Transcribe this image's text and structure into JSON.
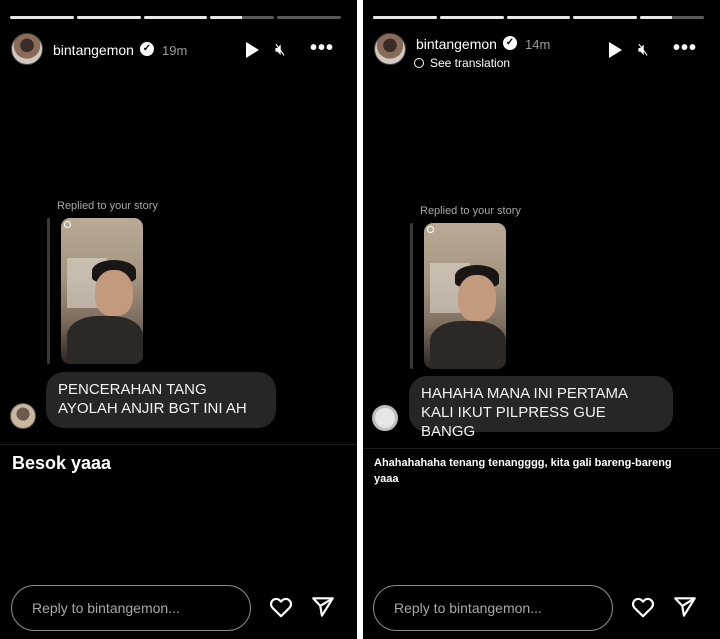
{
  "left": {
    "username": "bintangemon",
    "time": "19m",
    "replied_label": "Replied to your story",
    "message": "PENCERAHAN TANG AYOLAH ANJIR BGT INI AH",
    "caption": "Besok yaaa",
    "reply_placeholder": "Reply to bintangemon...",
    "progress": [
      1,
      1,
      1,
      0.5,
      0
    ]
  },
  "right": {
    "username": "bintangemon",
    "time": "14m",
    "see_translation": "See translation",
    "replied_label": "Replied to your story",
    "message": "HAHAHA MANA INI PERTAMA KALI IKUT PILPRESS GUE BANGG",
    "caption": "Ahahahahaha tenang tenangggg, kita gali bareng-bareng yaaa",
    "reply_placeholder": "Reply to bintangemon...",
    "progress": [
      1,
      1,
      1,
      1,
      0.5
    ]
  },
  "icons": [
    "verified-badge-icon",
    "play-icon",
    "mute-icon",
    "more-icon",
    "heart-icon",
    "send-icon",
    "globe-icon"
  ],
  "colors": {
    "background": "#000000",
    "bubble": "#262626",
    "text": "#ffffff",
    "muted": "#a8a8a8"
  }
}
